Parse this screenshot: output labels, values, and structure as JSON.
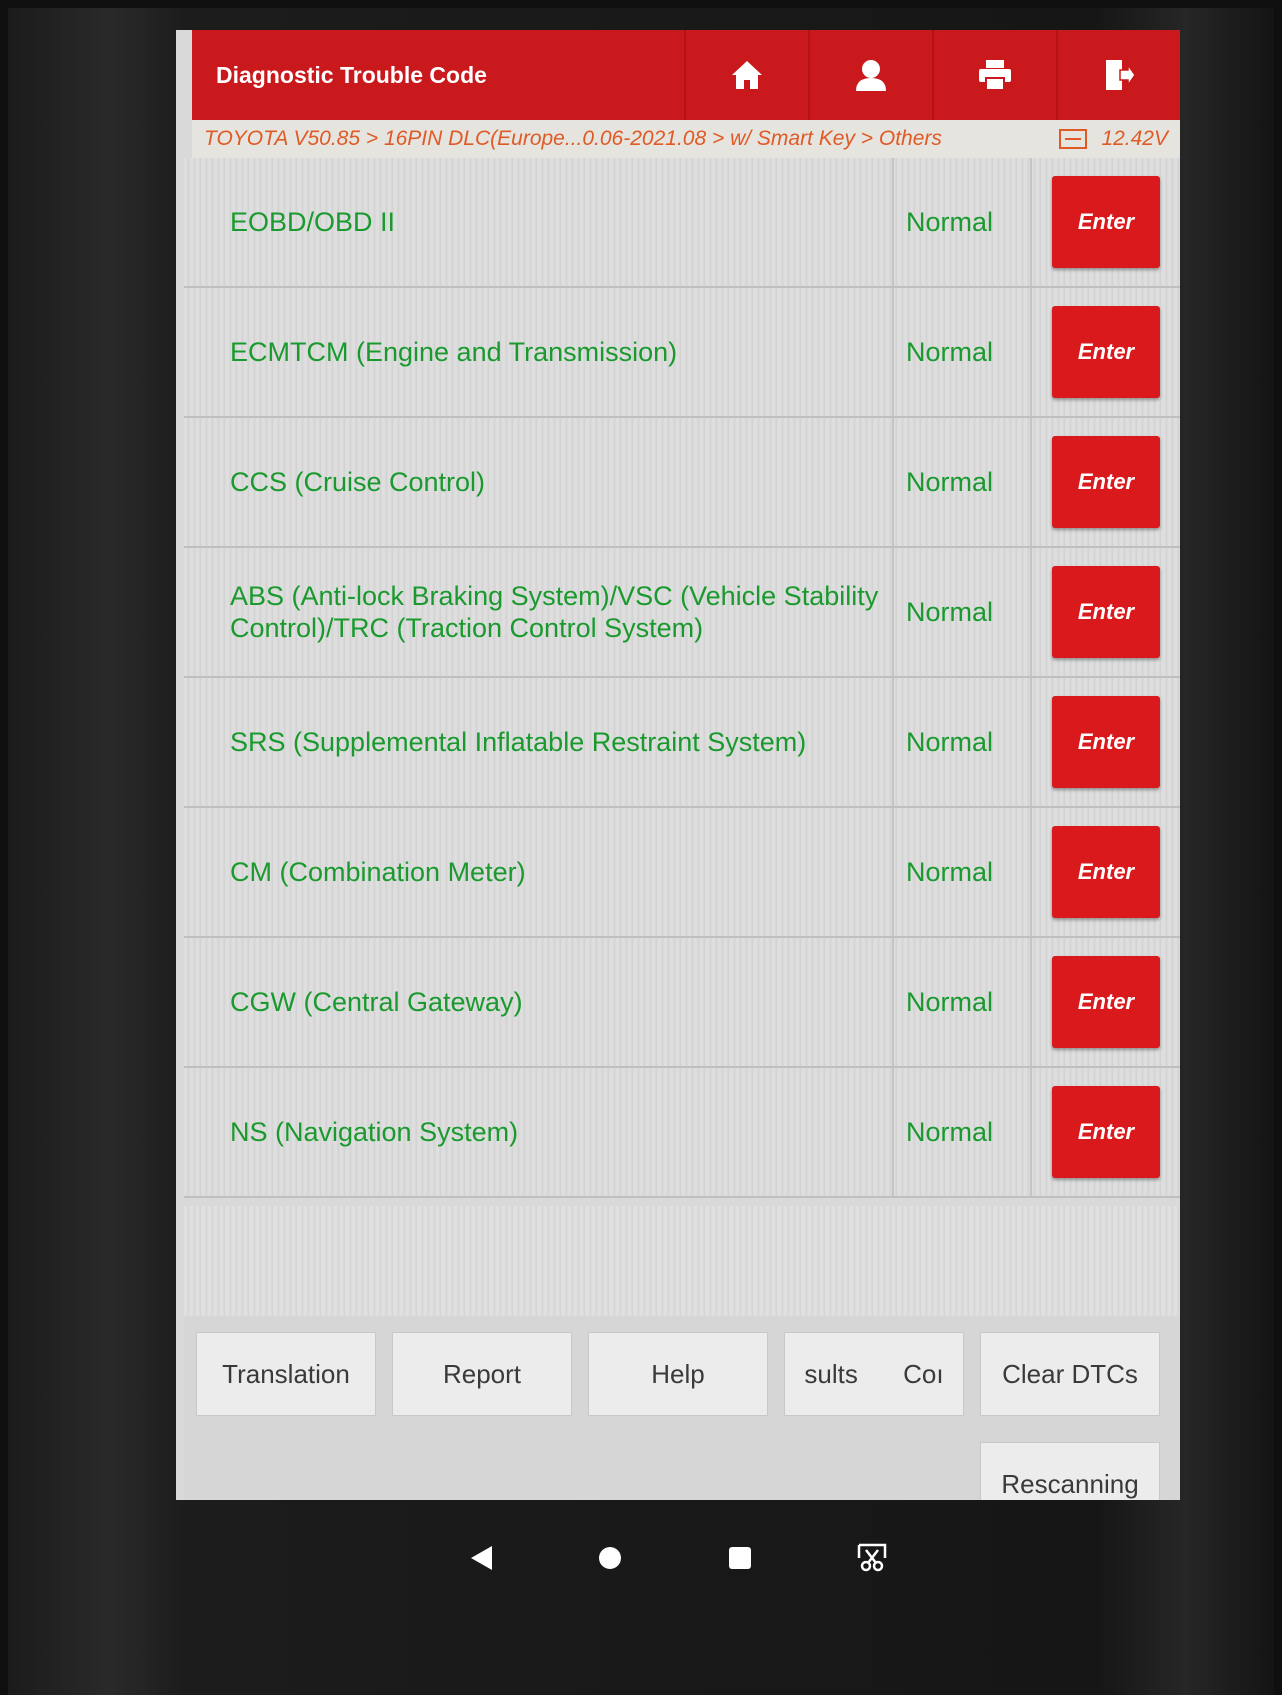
{
  "header": {
    "title": "Diagnostic Trouble Code",
    "buttons": [
      {
        "icon": "home-icon"
      },
      {
        "icon": "user-icon"
      },
      {
        "icon": "printer-icon"
      },
      {
        "icon": "exit-icon"
      }
    ]
  },
  "breadcrumb": {
    "path": "TOYOTA V50.85 > 16PIN DLC(Europe...0.06-2021.08 > w/ Smart Key > Others",
    "battery_icon": "battery-icon",
    "voltage": "12.42V"
  },
  "systems": [
    {
      "name": "EOBD/OBD II",
      "status": "Normal",
      "action": "Enter"
    },
    {
      "name": "ECMTCM (Engine and Transmission)",
      "status": "Normal",
      "action": "Enter"
    },
    {
      "name": "CCS (Cruise Control)",
      "status": "Normal",
      "action": "Enter"
    },
    {
      "name": "ABS (Anti-lock Braking System)/VSC (Vehicle Stability Control)/TRC (Traction Control System)",
      "status": "Normal",
      "action": "Enter"
    },
    {
      "name": "SRS (Supplemental Inflatable Restraint System)",
      "status": "Normal",
      "action": "Enter"
    },
    {
      "name": "CM (Combination Meter)",
      "status": "Normal",
      "action": "Enter"
    },
    {
      "name": "CGW (Central Gateway)",
      "status": "Normal",
      "action": "Enter"
    },
    {
      "name": "NS (Navigation System)",
      "status": "Normal",
      "action": "Enter"
    }
  ],
  "toolbar": {
    "translation": "Translation",
    "report": "Report",
    "help": "Help",
    "compare_results": "sults Coı",
    "clear_dtcs": "Clear DTCs",
    "rescanning": "Rescanning"
  },
  "android_nav": [
    "back-icon",
    "home-circle-icon",
    "recents-icon",
    "screenshot-icon"
  ],
  "colors": {
    "header_red": "#c9191c",
    "enter_red": "#d9191c",
    "status_green": "#1a9a2e",
    "breadcrumb_orange": "#e05a26"
  }
}
